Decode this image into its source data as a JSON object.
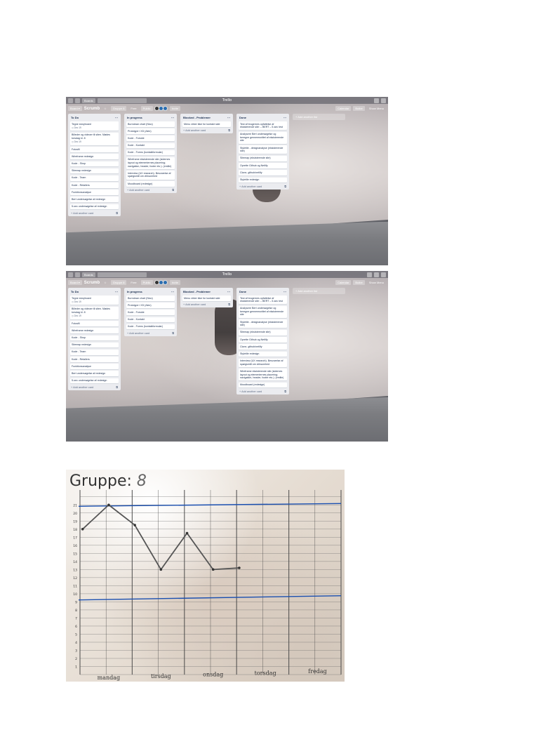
{
  "trello_top": {
    "topbar": {
      "boards_label": "Boards",
      "logo": "Trello"
    },
    "header": {
      "board_menu": "Board ▾",
      "board_name": "Scrumb",
      "team": "Gruppe 8",
      "team_badge": "Free",
      "visibility": "Public",
      "invite": "Invite",
      "calendar": "Calendar",
      "butler": "Butler",
      "show_menu": "Show Menu"
    },
    "lists": [
      {
        "title": "To Do",
        "cards": [
          {
            "text": "Tegne storyboard",
            "due": "Dec 19"
          },
          {
            "text": "Billeder og videoer til siten. Mødes torsdag kl. 8",
            "due": "Dec 19"
          },
          {
            "text": "Fotosfil"
          },
          {
            "text": "Wireframe redesign"
          },
          {
            "text": "Kode - Shop"
          },
          {
            "text": "Sitemap redesign"
          },
          {
            "text": "Kode - Team"
          },
          {
            "text": "Kode - Retailers"
          },
          {
            "text": "Funktionsanalyse"
          },
          {
            "text": "Bert undersøgelse af redesign"
          },
          {
            "text": "5-sec undersøgelse af redesign"
          }
        ],
        "add": "+ Add another card"
      },
      {
        "title": "In progress",
        "cards": [
          {
            "text": "Burndown chart (Nico)"
          },
          {
            "text": "Prototype i XD (Alex)"
          },
          {
            "text": "Kode - Forside"
          },
          {
            "text": "Kode - Kontakt"
          },
          {
            "text": "Kode - Forms (kontaktformular)"
          },
          {
            "text": "Wireframe eksisterende site (sidernes layout og elementernes placering; navigation, header, footer etc.). (emilie)"
          },
          {
            "text": "Interview (UX research). Besvarelse af spørgsmål om virksomhed"
          },
          {
            "text": "Moodboard (redesign)"
          }
        ],
        "add": "+ Add another card"
      },
      {
        "title": "Blocked - Problemer",
        "cards": [
          {
            "text": "Menu virker ikke for kontakt side"
          }
        ],
        "add": "+ Add another card"
      },
      {
        "title": "Done",
        "cards": [
          {
            "text": "Test af brugernes opfattelse af eksisterende site: – BERT – 5-sec test"
          },
          {
            "text": "Analysere Bert undersøgelse og beregne gennemsnittet af eksisterende site"
          },
          {
            "text": "Styletile - designanalyse (eksisterende site)"
          },
          {
            "text": "Sitemap (eksisterende site)"
          },
          {
            "text": "Oprette Github og Netlify"
          },
          {
            "text": "Clone, github/netlify"
          },
          {
            "text": "Styletile redesign"
          }
        ],
        "add": "+ Add another card"
      }
    ],
    "add_list": "+ Add another list"
  },
  "trello_bottom": {
    "topbar": {
      "boards_label": "Boards",
      "logo": "Trello"
    },
    "header": {
      "board_menu": "Board ▾",
      "board_name": "Scrumb",
      "team": "Gruppe 8",
      "team_badge": "Free",
      "visibility": "Public",
      "invite": "Invite",
      "calendar": "Calendar",
      "butler": "Butler",
      "show_menu": "Show Menu"
    },
    "lists": [
      {
        "title": "To Do",
        "cards": [
          {
            "text": "Tegne storyboard",
            "due": "Dec 19"
          },
          {
            "text": "Billeder og videoer til siten. Mødes torsdag kl. 8",
            "due": "Dec 19"
          },
          {
            "text": "Fotosfil"
          },
          {
            "text": "Wireframe redesign"
          },
          {
            "text": "Kode - Shop"
          },
          {
            "text": "Sitemap redesign"
          },
          {
            "text": "Kode - Team"
          },
          {
            "text": "Kode - Retailers"
          },
          {
            "text": "Funktionsanalyse"
          },
          {
            "text": "Bert undersøgelse af redesign"
          },
          {
            "text": "5-sec undersøgelse af redesign"
          }
        ],
        "add": "+ Add another card"
      },
      {
        "title": "In progress",
        "cards": [
          {
            "text": "Burndown chart (Nico)"
          },
          {
            "text": "Prototype i XD (Alex)"
          },
          {
            "text": "Kode - Forside"
          },
          {
            "text": "Kode - Kontakt"
          },
          {
            "text": "Kode - Forms (kontaktformular)"
          }
        ],
        "add": "+ Add another card"
      },
      {
        "title": "Blocked - Problemer",
        "cards": [
          {
            "text": "Menu virker ikke for kontakt side"
          }
        ],
        "add": "+ Add another card"
      },
      {
        "title": "Done",
        "cards": [
          {
            "text": "Test af brugernes opfattelse af eksisterende site: – BERT – 5-sec test"
          },
          {
            "text": "Analysere Bert undersøgelse og beregne gennemsnittet af eksisterende site"
          },
          {
            "text": "Styletile - designanalyse (eksisterende site)"
          },
          {
            "text": "Sitemap (eksisterende site)"
          },
          {
            "text": "Oprette Github og Netlify"
          },
          {
            "text": "Clone, github/netlify"
          },
          {
            "text": "Styletile redesign"
          },
          {
            "text": "Interview (UX research). Besvarelse af spørgsmål om virksomhed"
          },
          {
            "text": "Wireframe eksisterende site (sidernes layout og elementernes placering; navigation, header, footer etc.). (emilie)"
          },
          {
            "text": "Moodboard (redesign)"
          }
        ],
        "add": "+ Add another card"
      }
    ],
    "add_list": "+ Add another list"
  },
  "burndown": {
    "title": "Gruppe:",
    "group_number": "8",
    "chart_data": {
      "type": "line",
      "title": "Gruppe: 8",
      "x_labels": [
        "mandag",
        "tirsdag",
        "onsdag",
        "torsdag",
        "fredag"
      ],
      "y_ticks": [
        1,
        2,
        3,
        4,
        5,
        6,
        7,
        8,
        9,
        10,
        11,
        12,
        13,
        14,
        15,
        16,
        17,
        18,
        19,
        20,
        21
      ],
      "ylim": [
        1,
        21
      ],
      "series": [
        {
          "x": [
            0,
            0.5,
            1,
            1.5,
            2,
            2.5,
            3
          ],
          "y": [
            18,
            21,
            18.5,
            13,
            17.5,
            13,
            13.2
          ]
        }
      ],
      "ideal_start": 21,
      "ideal_end": 21,
      "baseline": 9.5,
      "grid": true,
      "line_color": "#555555",
      "guide_color": "#1a4fb0"
    }
  }
}
